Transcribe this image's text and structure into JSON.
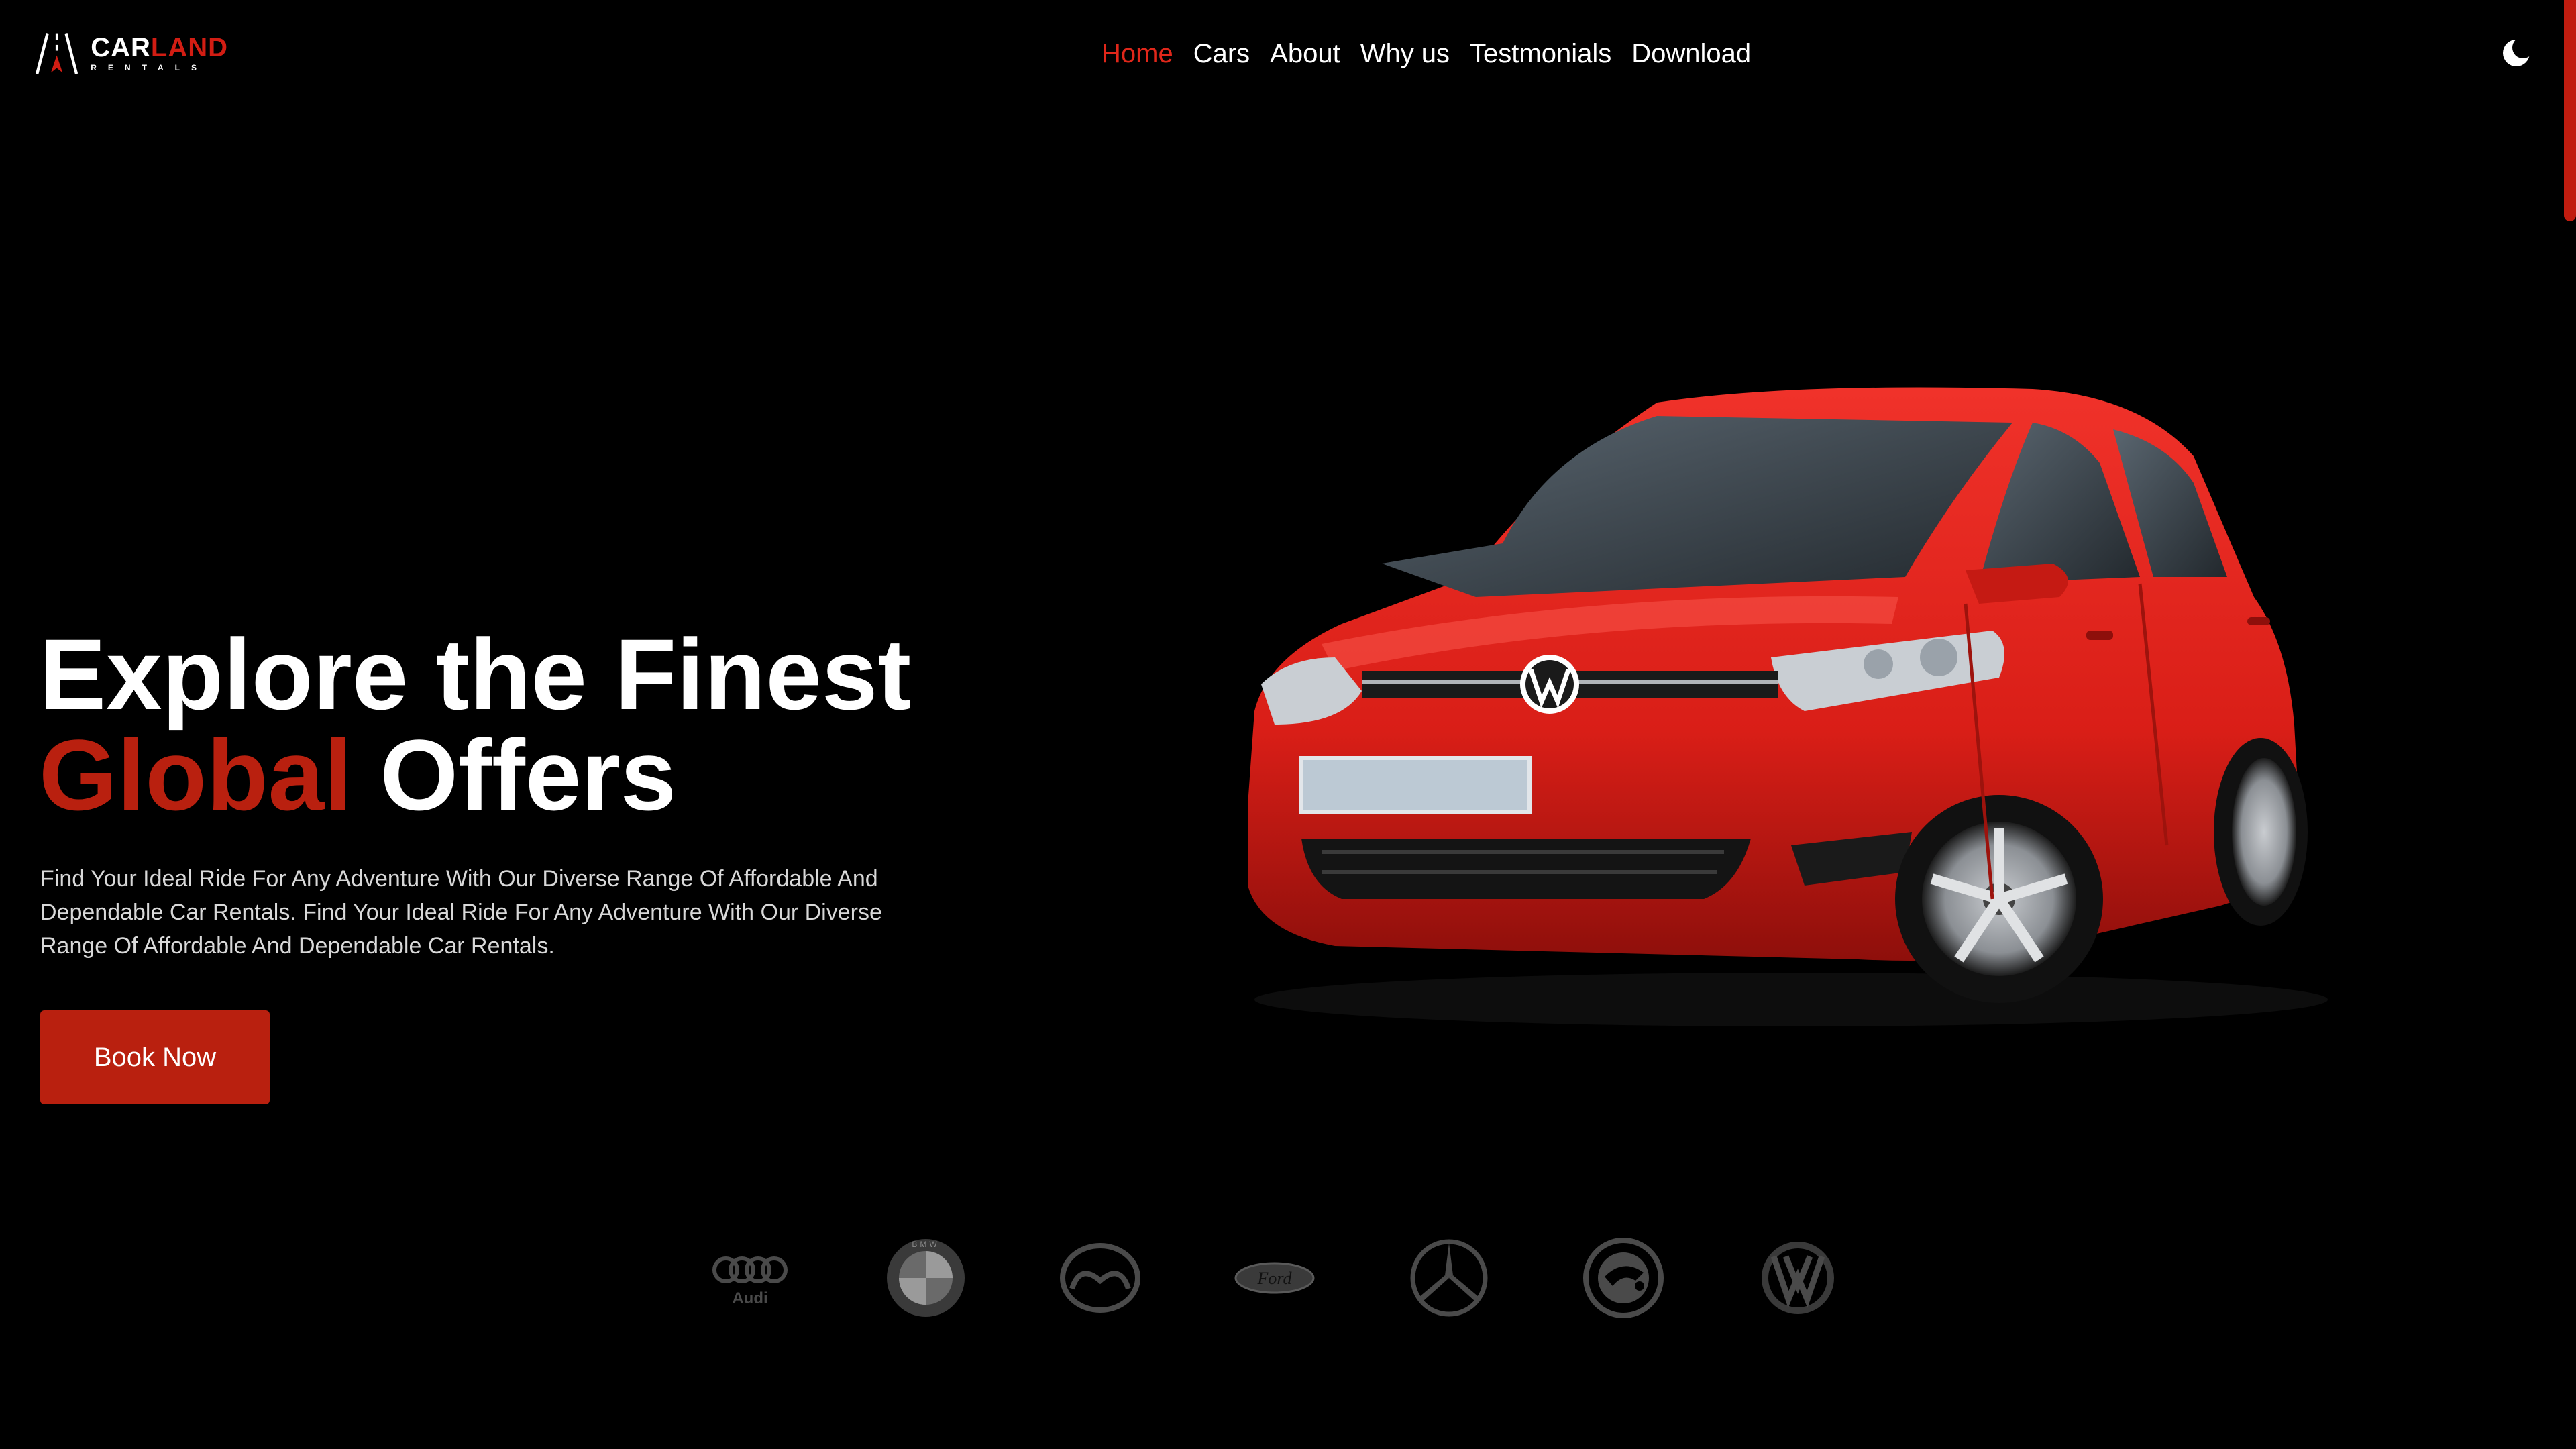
{
  "brand": {
    "title_part1": "CAR",
    "title_part2": "LAND",
    "subtitle": "RENTALS",
    "accent": "#d21d13"
  },
  "nav": {
    "items": [
      {
        "label": "Home",
        "active": true
      },
      {
        "label": "Cars",
        "active": false
      },
      {
        "label": "About",
        "active": false
      },
      {
        "label": "Why us",
        "active": false
      },
      {
        "label": "Testmonials",
        "active": false
      },
      {
        "label": "Download",
        "active": false
      }
    ],
    "theme_toggle_icon": "moon-icon"
  },
  "hero": {
    "headline_line1": "Explore the Finest",
    "headline_highlight": "Global",
    "headline_rest": " Offers",
    "description": "Find Your Ideal Ride For Any Adventure With Our Diverse Range Of Affordable And Dependable Car Rentals. Find Your Ideal Ride For Any Adventure With Our Diverse Range Of Affordable And Dependable Car Rentals.",
    "cta_label": "Book Now",
    "image": "red-hatchback-car"
  },
  "brands": {
    "items": [
      {
        "name": "audi",
        "icon": "audi-logo-icon",
        "label": "Audi"
      },
      {
        "name": "bmw",
        "icon": "bmw-logo-icon",
        "label": "BMW"
      },
      {
        "name": "mazda",
        "icon": "mazda-logo-icon"
      },
      {
        "name": "ford",
        "icon": "ford-logo-icon",
        "label": "Ford"
      },
      {
        "name": "mercedes",
        "icon": "mercedes-logo-icon"
      },
      {
        "name": "skoda",
        "icon": "skoda-logo-icon"
      },
      {
        "name": "volkswagen",
        "icon": "vw-logo-icon"
      }
    ]
  },
  "colors": {
    "background": "#000000",
    "accent_red": "#b9200f",
    "text": "#ffffff",
    "muted_text": "#d8d8d8",
    "brand_grey": "#4a4a4a"
  }
}
